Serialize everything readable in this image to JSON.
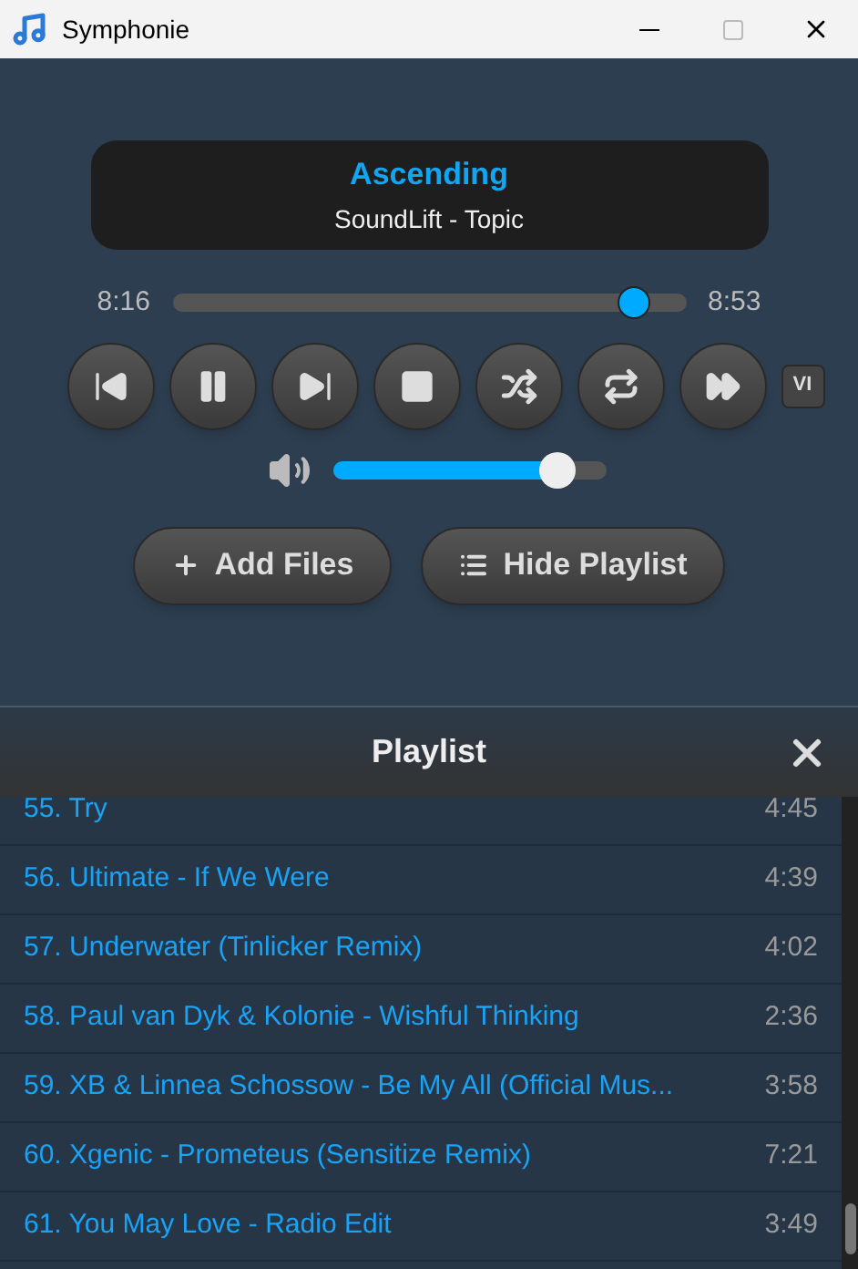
{
  "window": {
    "title": "Symphonie"
  },
  "now_playing": {
    "title": "Ascending",
    "artist": "SoundLift - Topic"
  },
  "progress": {
    "elapsed": "8:16",
    "total": "8:53",
    "level": 0.9
  },
  "transport_badge": "VI",
  "volume": {
    "level": 0.82
  },
  "buttons": [
    {
      "kind": "add",
      "label": "Add Files"
    },
    {
      "kind": "playlist",
      "label": "Hide Playlist"
    }
  ],
  "playlist": {
    "title": "Playlist",
    "items": [
      {
        "title": "55. Try",
        "duration": "4:45"
      },
      {
        "title": "56. Ultimate - If We Were",
        "duration": "4:39"
      },
      {
        "title": "57. Underwater (Tinlicker Remix)",
        "duration": "4:02"
      },
      {
        "title": "58. Paul van Dyk & Kolonie - Wishful Thinking",
        "duration": "2:36"
      },
      {
        "title": "59. XB & Linnea Schossow - Be My All (Official Mus...",
        "duration": "3:58"
      },
      {
        "title": "60. Xgenic - Prometeus (Sensitize Remix)",
        "duration": "7:21"
      },
      {
        "title": "61. You May Love - Radio Edit",
        "duration": "3:49"
      }
    ]
  }
}
